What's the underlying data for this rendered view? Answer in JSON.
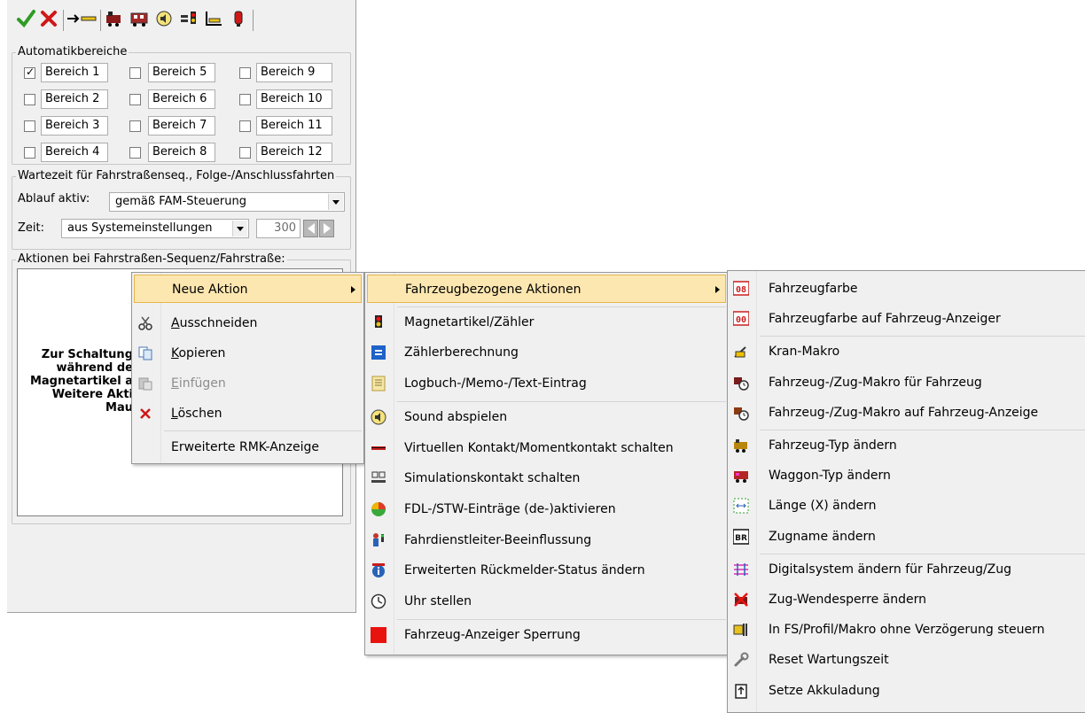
{
  "toolbar": {
    "icons": [
      "ok-check-icon",
      "cancel-x-icon",
      "arrow-track-icon",
      "locomotive-icon",
      "wagon-icon",
      "sound-icon",
      "signal-icon",
      "chart-icon",
      "lamp-icon"
    ],
    "colors": {
      "ok": "#2e9b25",
      "cancel": "#d01818"
    }
  },
  "auto_areas": {
    "legend": "Automatikbereiche",
    "items": [
      {
        "label": "Bereich 1",
        "checked": true
      },
      {
        "label": "Bereich 5",
        "checked": false
      },
      {
        "label": "Bereich 9",
        "checked": false
      },
      {
        "label": "Bereich 2",
        "checked": false
      },
      {
        "label": "Bereich 6",
        "checked": false
      },
      {
        "label": "Bereich 10",
        "checked": false
      },
      {
        "label": "Bereich 3",
        "checked": false
      },
      {
        "label": "Bereich 7",
        "checked": false
      },
      {
        "label": "Bereich 11",
        "checked": false
      },
      {
        "label": "Bereich 4",
        "checked": false
      },
      {
        "label": "Bereich 8",
        "checked": false
      },
      {
        "label": "Bereich 12",
        "checked": false
      }
    ]
  },
  "wait": {
    "legend": "Wartezeit für Fahrstraßenseq., Folge-/Anschlussfahrten",
    "ablauf_label": "Ablauf aktiv:",
    "ablauf_value": "gemäß FAM-Steuerung",
    "zeit_label": "Zeit:",
    "zeit_value": "aus Systemeinstellungen",
    "zeit_number": "300"
  },
  "actions": {
    "legend": "Aktionen bei Fahrstraßen-Sequenz/Fahrstraße:",
    "hint_lines": [
      "Zur Schaltung",
      "während de",
      "Magnetartikel a",
      "Weitere Akti",
      "Mau"
    ]
  },
  "menu1": {
    "items": [
      {
        "label": "Neue Aktion",
        "icon": "",
        "highlighted": true,
        "submenu": true
      },
      {
        "label": "Ausschneiden",
        "icon": "scissors-icon"
      },
      {
        "label": "Kopieren",
        "icon": "copy-icon"
      },
      {
        "label": "Einfügen",
        "icon": "paste-icon",
        "disabled": true
      },
      {
        "label": "Löschen",
        "icon": "delete-x-icon"
      },
      {
        "label": "Erweiterte RMK-Anzeige",
        "icon": ""
      }
    ]
  },
  "menu2": {
    "items": [
      {
        "label": "Fahrzeugbezogene Aktionen",
        "icon": "",
        "highlighted": true,
        "submenu": true
      },
      {
        "label": "Magnetartikel/Zähler",
        "icon": "signal-light-icon"
      },
      {
        "label": "Zählerberechnung",
        "icon": "equals-icon"
      },
      {
        "label": "Logbuch-/Memo-/Text-Eintrag",
        "icon": "logbook-icon"
      },
      {
        "label": "Sound abspielen",
        "icon": "speaker-icon"
      },
      {
        "label": "Virtuellen Kontakt/Momentkontakt schalten",
        "icon": "contact-icon"
      },
      {
        "label": "Simulationskontakt schalten",
        "icon": "simulation-icon"
      },
      {
        "label": "FDL-/STW-Einträge (de-)aktivieren",
        "icon": "fdl-icon"
      },
      {
        "label": "Fahrdienstleiter-Beeinflussung",
        "icon": "dispatcher-icon"
      },
      {
        "label": "Erweiterten Rückmelder-Status ändern",
        "icon": "info-icon"
      },
      {
        "label": "Uhr stellen",
        "icon": "clock-icon"
      },
      {
        "label": "Fahrzeug-Anzeiger Sperrung",
        "icon": "red-square-icon"
      }
    ]
  },
  "menu3": {
    "items": [
      {
        "label": "Fahrzeugfarbe",
        "icon": "vehicle-color-icon",
        "badge": "08"
      },
      {
        "label": "Fahrzeugfarbe auf Fahrzeug-Anzeiger",
        "icon": "vehicle-color-display-icon",
        "badge": "00"
      },
      {
        "label": "Kran-Makro",
        "icon": "crane-icon"
      },
      {
        "label": "Fahrzeug-/Zug-Makro für Fahrzeug",
        "icon": "vehicle-macro-icon"
      },
      {
        "label": "Fahrzeug-/Zug-Makro auf Fahrzeug-Anzeige",
        "icon": "vehicle-macro-display-icon"
      },
      {
        "label": "Fahrzeug-Typ ändern",
        "icon": "vehicle-type-icon"
      },
      {
        "label": "Waggon-Typ ändern",
        "icon": "wagon-type-icon"
      },
      {
        "label": "Länge (X) ändern",
        "icon": "length-icon"
      },
      {
        "label": "Zugname ändern",
        "icon": "train-name-icon",
        "badge": "BR"
      },
      {
        "label": "Digitalsystem ändern für Fahrzeug/Zug",
        "icon": "digital-system-icon"
      },
      {
        "label": "Zug-Wendesperre ändern",
        "icon": "reverse-lock-icon"
      },
      {
        "label": "In FS/Profil/Makro ohne Verzögerung steuern",
        "icon": "no-delay-icon"
      },
      {
        "label": "Reset Wartungszeit",
        "icon": "wrench-icon"
      },
      {
        "label": "Setze Akkuladung",
        "icon": "battery-icon"
      }
    ]
  }
}
